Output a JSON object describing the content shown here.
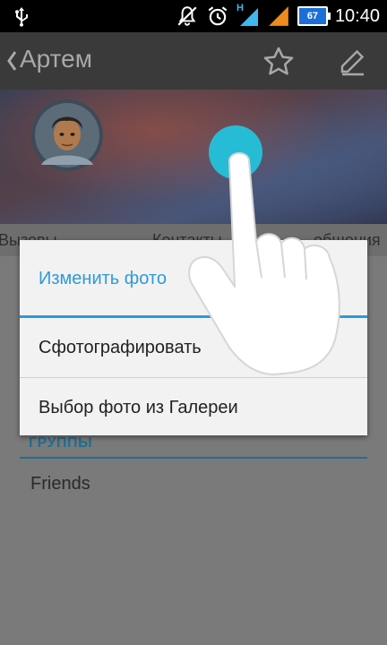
{
  "status_bar": {
    "time": "10:40",
    "battery": "67",
    "network_label": "H",
    "icons": [
      "usb-icon",
      "mute-icon",
      "alarm-icon",
      "signal-icon",
      "signal-icon-2",
      "battery-icon"
    ]
  },
  "action_bar": {
    "title": "Артем",
    "icons": [
      "back-chevron-icon",
      "star-icon",
      "edit-icon"
    ]
  },
  "tabs": [
    {
      "label": "Вызовы"
    },
    {
      "label": "Контакты"
    },
    {
      "label": "общения"
    }
  ],
  "content": {
    "groups_header": "ГРУППЫ",
    "groups": [
      "Friends"
    ]
  },
  "dialog": {
    "title": "Изменить фото",
    "items": [
      {
        "label": "Сфотографировать"
      },
      {
        "label": "Выбор фото из Галереи"
      }
    ]
  },
  "colors": {
    "accent": "#2e9bd6",
    "touch_indicator": "#27bcd6",
    "dim_background": "#7a7a7a",
    "status_bar": "#000000"
  }
}
